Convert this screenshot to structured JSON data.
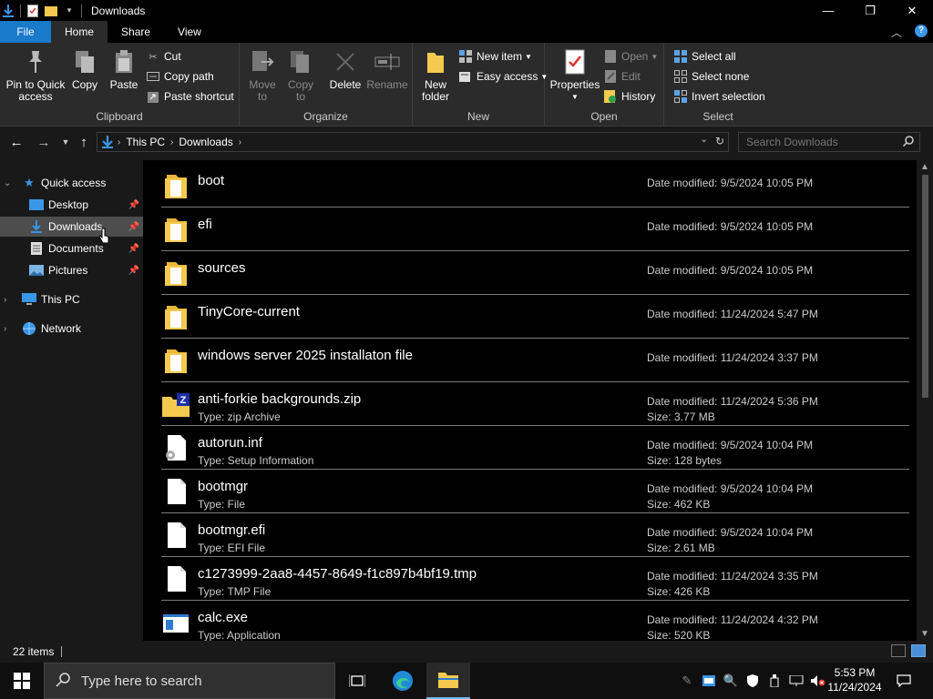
{
  "window": {
    "title": "Downloads",
    "controls": {
      "minimize": "—",
      "maximize": "❐",
      "close": "✕"
    }
  },
  "ribbon_tabs": [
    {
      "label": "File"
    },
    {
      "label": "Home"
    },
    {
      "label": "Share"
    },
    {
      "label": "View"
    }
  ],
  "ribbon": {
    "clipboard": {
      "label": "Clipboard",
      "pin": "Pin to Quick access",
      "pin_line1": "Pin to Quick",
      "pin_line2": "access",
      "copy": "Copy",
      "paste": "Paste",
      "cut": "Cut",
      "copy_path": "Copy path",
      "paste_shortcut": "Paste shortcut"
    },
    "organize": {
      "label": "Organize",
      "move_line1": "Move",
      "move_line2": "to",
      "copy_line1": "Copy",
      "copy_line2": "to",
      "delete": "Delete",
      "rename": "Rename"
    },
    "new": {
      "label": "New",
      "folder_line1": "New",
      "folder_line2": "folder",
      "new_item": "New item",
      "easy_access": "Easy access"
    },
    "open": {
      "label": "Open",
      "properties": "Properties",
      "open": "Open",
      "edit": "Edit",
      "history": "History"
    },
    "select": {
      "label": "Select",
      "select_all": "Select all",
      "select_none": "Select none",
      "invert": "Invert selection"
    }
  },
  "address": {
    "crumbs": [
      "This PC",
      "Downloads"
    ],
    "search_placeholder": "Search Downloads"
  },
  "nav_pane": {
    "quick_access": "Quick access",
    "items": [
      {
        "label": "Desktop"
      },
      {
        "label": "Downloads"
      },
      {
        "label": "Documents"
      },
      {
        "label": "Pictures"
      }
    ],
    "this_pc": "This PC",
    "network": "Network"
  },
  "files": [
    {
      "name": "boot",
      "type": "",
      "date": "Date modified: 9/5/2024 10:05 PM",
      "size": "",
      "icon": "folder-icon"
    },
    {
      "name": "efi",
      "type": "",
      "date": "Date modified: 9/5/2024 10:05 PM",
      "size": "",
      "icon": "folder-icon"
    },
    {
      "name": "sources",
      "type": "",
      "date": "Date modified: 9/5/2024 10:05 PM",
      "size": "",
      "icon": "folder-icon"
    },
    {
      "name": "TinyCore-current",
      "type": "",
      "date": "Date modified: 11/24/2024 5:47 PM",
      "size": "",
      "icon": "folder-icon"
    },
    {
      "name": "windows server 2025 installaton file",
      "type": "",
      "date": "Date modified: 11/24/2024 3:37 PM",
      "size": "",
      "icon": "folder-icon"
    },
    {
      "name": "anti-forkie backgrounds.zip",
      "type": "Type: zip Archive",
      "date": "Date modified: 11/24/2024 5:36 PM",
      "size": "Size: 3.77 MB",
      "icon": "zip-icon"
    },
    {
      "name": "autorun.inf",
      "type": "Type: Setup Information",
      "date": "Date modified: 9/5/2024 10:04 PM",
      "size": "Size: 128 bytes",
      "icon": "setup-file-icon"
    },
    {
      "name": "bootmgr",
      "type": "Type: File",
      "date": "Date modified: 9/5/2024 10:04 PM",
      "size": "Size: 462 KB",
      "icon": "file-icon"
    },
    {
      "name": "bootmgr.efi",
      "type": "Type: EFI File",
      "date": "Date modified: 9/5/2024 10:04 PM",
      "size": "Size: 2.61 MB",
      "icon": "file-icon"
    },
    {
      "name": "c1273999-2aa8-4457-8649-f1c897b4bf19.tmp",
      "type": "Type: TMP File",
      "date": "Date modified: 11/24/2024 3:35 PM",
      "size": "Size: 426 KB",
      "icon": "file-icon"
    },
    {
      "name": "calc.exe",
      "type": "Type: Application",
      "date": "Date modified: 11/24/2024 4:32 PM",
      "size": "Size: 520 KB",
      "icon": "application-icon"
    }
  ],
  "status": {
    "count": "22 items"
  },
  "taskbar": {
    "search_placeholder": "Type here to search",
    "time": "5:53 PM",
    "date": "11/24/2024"
  },
  "colors": {
    "accent": "#1979ca",
    "folder": "#f3c94e",
    "selection": "#4d4d4d"
  }
}
